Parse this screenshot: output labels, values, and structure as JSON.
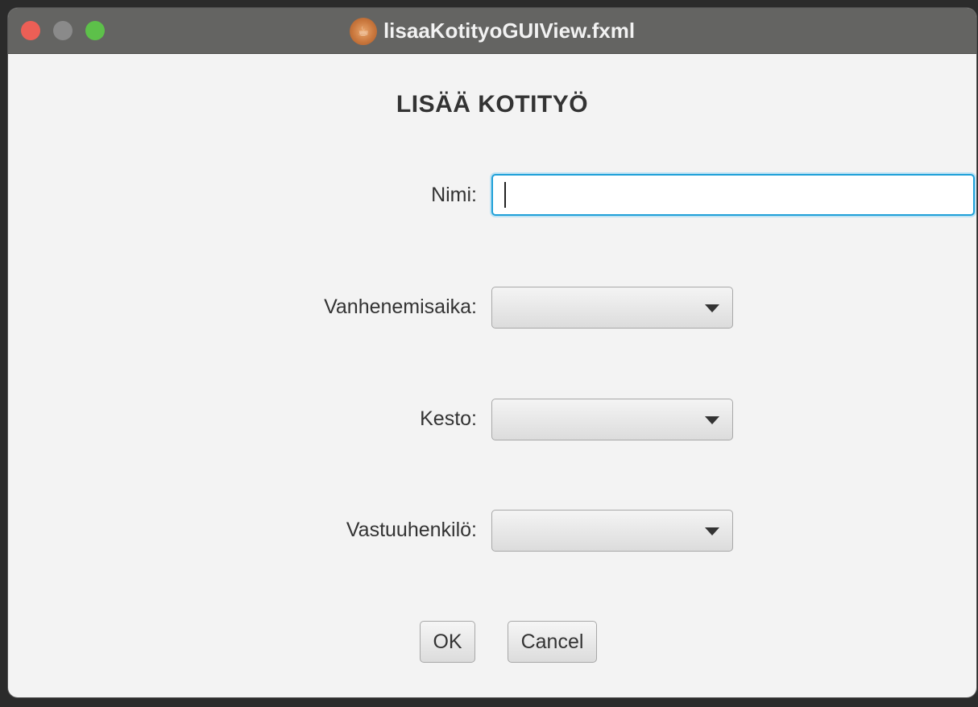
{
  "window": {
    "title": "lisaaKotityoGUIView.fxml",
    "app_icon": "java-app-icon"
  },
  "form": {
    "heading": "LISÄÄ KOTITYÖ",
    "nimi": {
      "label": "Nimi:",
      "value": ""
    },
    "vanhenemisaika": {
      "label": "Vanhenemisaika:",
      "selected": ""
    },
    "kesto": {
      "label": "Kesto:",
      "selected": ""
    },
    "vastuuhenkilo": {
      "label": "Vastuuhenkilö:",
      "selected": ""
    }
  },
  "buttons": {
    "ok": "OK",
    "cancel": "Cancel"
  },
  "colors": {
    "focus_border": "#1fa0d8",
    "titlebar": "#646462",
    "background": "#f3f3f3"
  }
}
